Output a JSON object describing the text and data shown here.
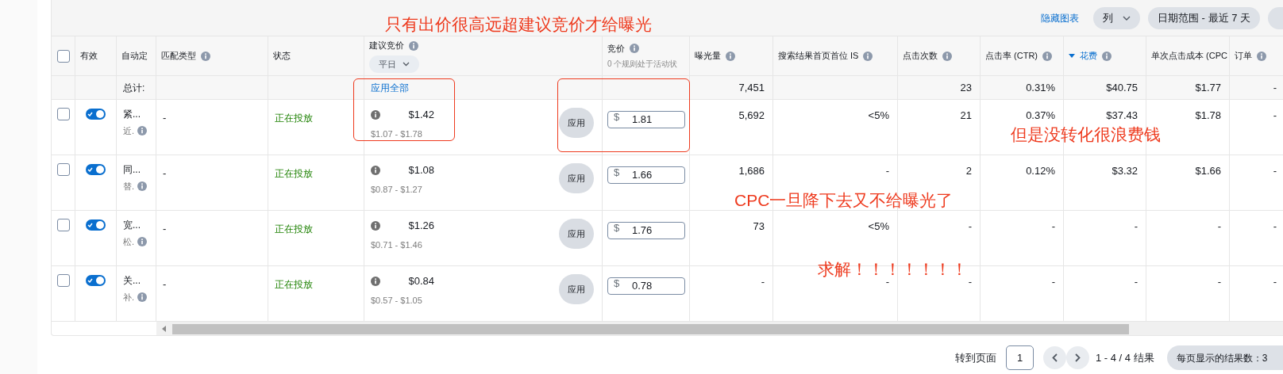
{
  "toolbar": {
    "hide_chart": "隐藏图表",
    "columns_button": "列",
    "date_range": "日期范围 - 最近 7 天"
  },
  "header": {
    "checked": false,
    "columns": [
      {
        "label": "有效",
        "info": false,
        "sorted": false
      },
      {
        "label": "自动定",
        "info": false,
        "sorted": false
      },
      {
        "label": "匹配类型",
        "info": true,
        "sorted": false
      },
      {
        "label": "状态",
        "info": false,
        "sorted": false
      },
      {
        "label": "建议竞价",
        "info": true,
        "sorted": false,
        "dropdown": "平日"
      },
      {
        "label": "竞价",
        "info": true,
        "sorted": false,
        "sub": "0 个规则处于活动状"
      },
      {
        "label": "曝光量",
        "info": true,
        "sorted": false
      },
      {
        "label": "搜索结果首页首位 IS",
        "info": true,
        "sorted": false
      },
      {
        "label": "点击次数",
        "info": true,
        "sorted": false
      },
      {
        "label": "点击率 (CTR)",
        "info": true,
        "sorted": false
      },
      {
        "label": "花费",
        "info": true,
        "sorted": true
      },
      {
        "label": "单次点击成本 (CPC",
        "info": false,
        "sorted": false
      },
      {
        "label": "订单",
        "info": true,
        "sorted": false
      }
    ]
  },
  "totals": {
    "label": "总计:",
    "apply_all": "应用全部",
    "impressions": "7,451",
    "clicks": "23",
    "ctr": "0.31%",
    "spend": "$40.75",
    "cpc": "$1.77",
    "orders": "-"
  },
  "rows": [
    {
      "checked": false,
      "on": true,
      "name": "紧...",
      "sub": "近.",
      "match_type": "-",
      "status": "正在投放",
      "suggested_bid": "$1.42",
      "range": "$1.07 - $1.78",
      "apply": "应用",
      "currency": "$",
      "bid": "1.81",
      "impressions": "5,692",
      "top_is": "<5%",
      "clicks": "21",
      "ctr": "0.37%",
      "spend": "$37.43",
      "cpc": "$1.78",
      "orders": "-"
    },
    {
      "checked": false,
      "on": true,
      "name": "同...",
      "sub": "替.",
      "match_type": "-",
      "status": "正在投放",
      "suggested_bid": "$1.08",
      "range": "$0.87 - $1.27",
      "apply": "应用",
      "currency": "$",
      "bid": "1.66",
      "impressions": "1,686",
      "top_is": "-",
      "clicks": "2",
      "ctr": "0.12%",
      "spend": "$3.32",
      "cpc": "$1.66",
      "orders": "-"
    },
    {
      "checked": false,
      "on": true,
      "name": "宽...",
      "sub": "松.",
      "match_type": "-",
      "status": "正在投放",
      "suggested_bid": "$1.26",
      "range": "$0.71 - $1.46",
      "apply": "应用",
      "currency": "$",
      "bid": "1.76",
      "impressions": "73",
      "top_is": "<5%",
      "clicks": "-",
      "ctr": "-",
      "spend": "-",
      "cpc": "-",
      "orders": "-"
    },
    {
      "checked": false,
      "on": true,
      "name": "关...",
      "sub": "补.",
      "match_type": "-",
      "status": "正在投放",
      "suggested_bid": "$0.84",
      "range": "$0.57 - $1.05",
      "apply": "应用",
      "currency": "$",
      "bid": "0.78",
      "impressions": "-",
      "top_is": "-",
      "clicks": "-",
      "ctr": "-",
      "spend": "-",
      "cpc": "-",
      "orders": "-"
    }
  ],
  "footer": {
    "goto_label": "转到页面",
    "page": "1",
    "range": "1 - 4 / 4 结果",
    "per_page": "每页显示的结果数：3"
  },
  "annotations": [
    {
      "kind": "text",
      "text": "只有出价很高远超建议竞价才给曝光"
    },
    {
      "kind": "box"
    },
    {
      "kind": "box"
    },
    {
      "kind": "text",
      "text": "但是没转化很浪费钱"
    },
    {
      "kind": "text",
      "text": "CPC一旦降下去又不给曝光了"
    },
    {
      "kind": "text",
      "text": "求解！！！！！！！"
    }
  ]
}
